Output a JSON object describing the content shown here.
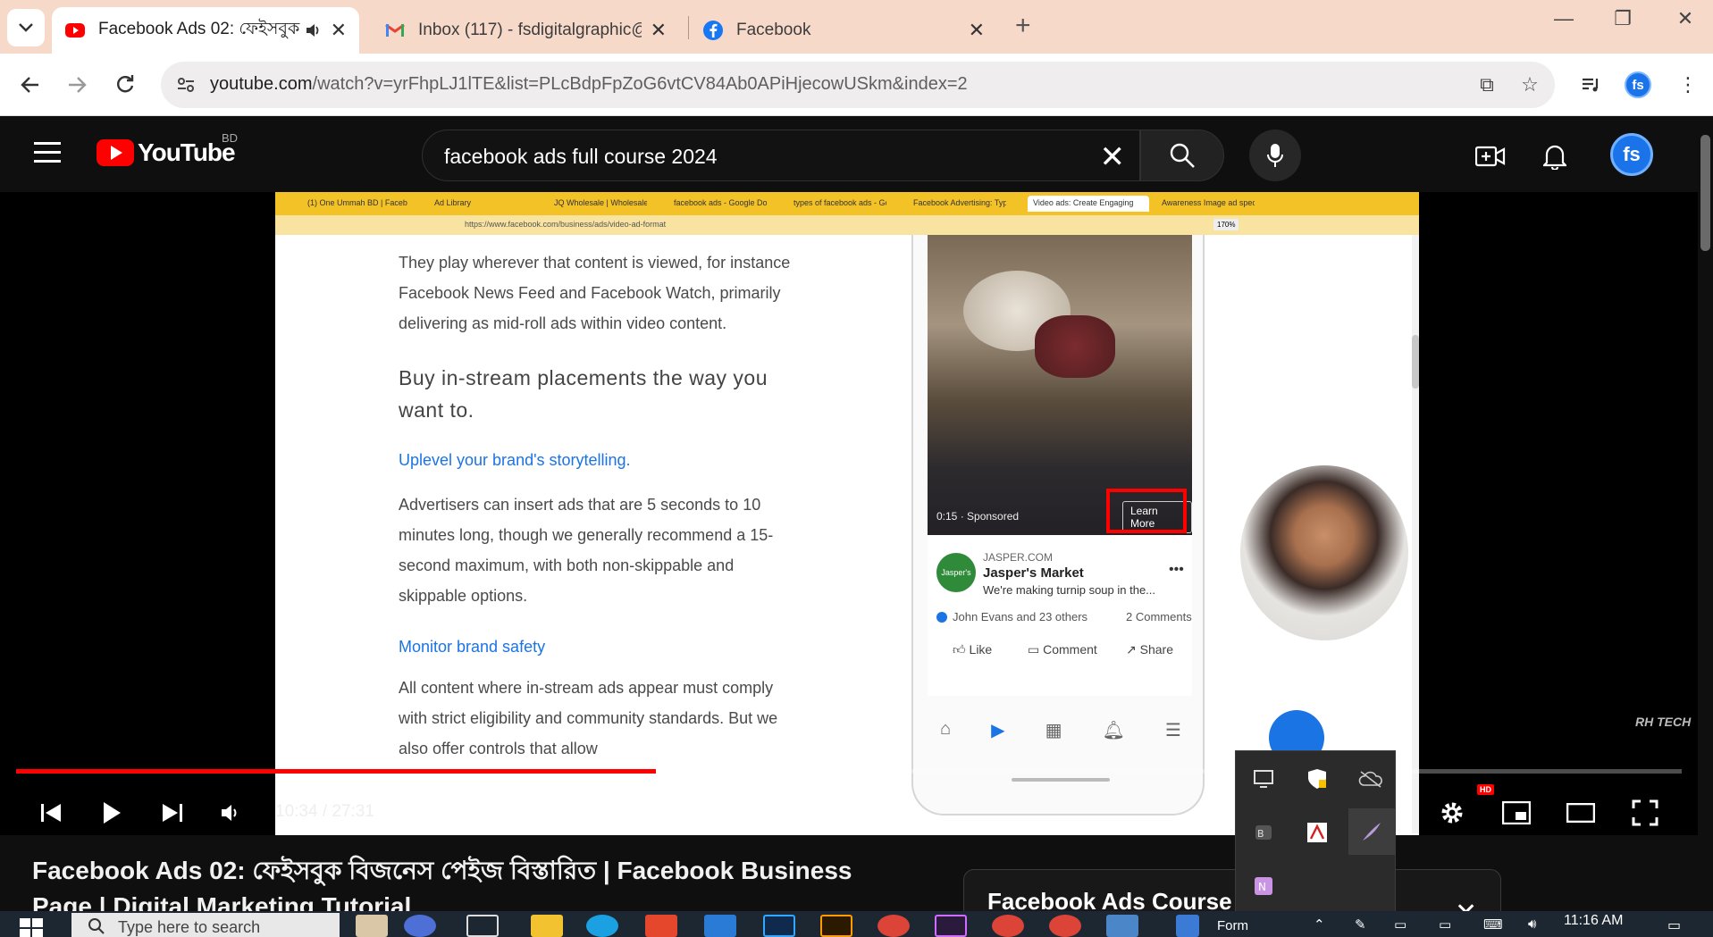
{
  "browser": {
    "tabs": [
      {
        "title": "Facebook Ads 02: ফেইসবুক",
        "active": true,
        "favicon": "youtube-icon",
        "audio": true
      },
      {
        "title": "Inbox (117) - fsdigitalgraphic@",
        "active": false,
        "favicon": "gmail-icon"
      },
      {
        "title": "Facebook",
        "active": false,
        "favicon": "facebook-icon"
      }
    ],
    "url_host": "youtube.com",
    "url_rest": "/watch?v=yrFhpLJ1lTE&list=PLcBdpFpZoG6vtCV84Ab0APiHjecowUSkm&index=2"
  },
  "youtube": {
    "region": "BD",
    "logo_text": "YouTube",
    "search_query": "facebook ads full course 2024",
    "avatar_initials": "fs"
  },
  "inner_browser": {
    "tabs": [
      "(1) One Ummah BD | Faceb",
      "Ad Library",
      "JQ Wholesale | Wholesale",
      "facebook ads - Google Doc",
      "types of facebook ads - Go",
      "Facebook Advertising: Type",
      "Video ads: Create Engaging",
      "Awareness Image ad specs"
    ],
    "url": "https://www.facebook.com/business/ads/video-ad-format",
    "zoom": "170%"
  },
  "article": {
    "para1": "They play wherever that content is viewed, for instance Facebook News Feed and Facebook Watch, primarily delivering as mid-roll ads within video content.",
    "heading": "Buy in-stream placements the way you want to.",
    "link1": "Uplevel your brand's storytelling.",
    "para2": "Advertisers can insert ads that are 5 seconds to 10 minutes long, though we generally recommend a 15-second maximum, with both non-skippable and skippable options.",
    "link2": "Monitor brand safety",
    "para3": "All content where in-stream ads appear must comply with strict eligibility and community standards. But we also offer controls that allow"
  },
  "ad_mock": {
    "time": "0:15 · Sponsored",
    "cta": "Learn More",
    "domain": "JASPER.COM",
    "brand": "Jasper's Market",
    "text": "We're making turnip soup in the...",
    "reactions": "John Evans and 23 others",
    "comments": "2 Comments",
    "like": "Like",
    "comment": "Comment",
    "share": "Share",
    "logo_text": "Jasper's"
  },
  "watermark": "RH TECH",
  "player": {
    "time": "10:34 / 27:31",
    "progress_fraction": 0.384,
    "hd": "HD"
  },
  "video_title": "Facebook Ads 02: ফেইসবুক বিজনেস পেইজ বিস্তারিত | Facebook Business Page | Digital Marketing Tutorial",
  "playlist_title": "Facebook Ads Course",
  "taskbar": {
    "search_placeholder": "Type here to search",
    "clock": "11:16 AM",
    "file_label": "Form"
  },
  "colors": {
    "youtube_red": "#ff0000",
    "chrome_tabstrip": "#f7d9c9",
    "inner_tabbar": "#f3c227",
    "fb_blue": "#1b74e4"
  }
}
